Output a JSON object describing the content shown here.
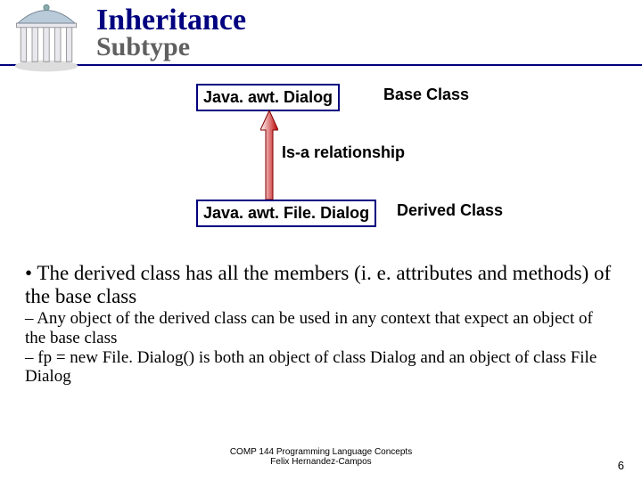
{
  "header": {
    "title": "Inheritance",
    "subtitle": "Subtype"
  },
  "diagram": {
    "base_class_box": "Java. awt. Dialog",
    "base_class_label": "Base Class",
    "relationship": "Is-a relationship",
    "derived_class_box": "Java. awt. File. Dialog",
    "derived_class_label": "Derived Class"
  },
  "bullets": {
    "main": "The derived class has all the members (i. e. attributes and methods) of the base class",
    "sub1": "Any object of the derived class can be used in any context that expect an object of the base class",
    "sub2": "fp = new File. Dialog() is both an object of class Dialog and an object of class File Dialog"
  },
  "footer": {
    "line1": "COMP 144 Programming Language Concepts",
    "line2": "Felix Hernandez-Campos"
  },
  "page_number": "6"
}
